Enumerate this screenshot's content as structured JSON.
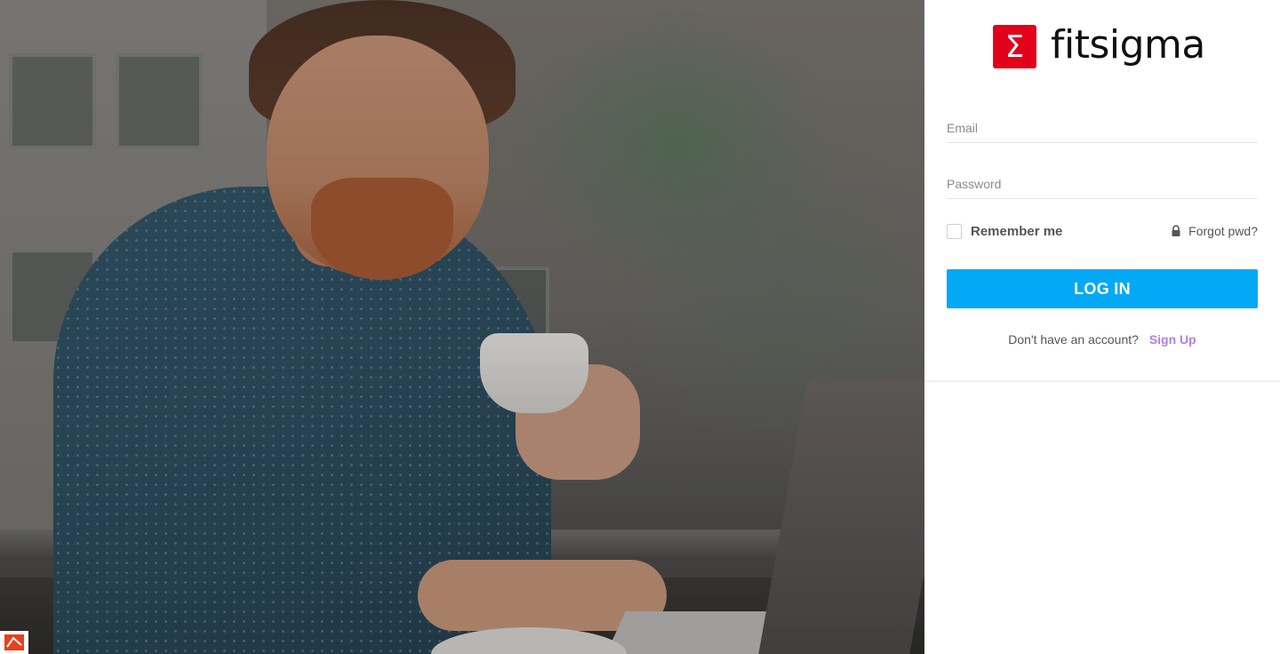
{
  "brand": {
    "name": "fitsigma",
    "mark_glyph": "Σ",
    "mark_color": "#e3001b"
  },
  "login_form": {
    "email_placeholder": "Email",
    "password_placeholder": "Password",
    "remember_label": "Remember me",
    "forgot_label": "Forgot pwd?",
    "forgot_icon": "lock-icon",
    "login_button_label": "LOG IN",
    "login_button_color": "#03a9f4",
    "signup_prompt": "Don't have an account?",
    "signup_link_label": "Sign Up",
    "signup_link_color": "#b57edc"
  },
  "hero": {
    "image_alt": "photo-placeholder"
  }
}
